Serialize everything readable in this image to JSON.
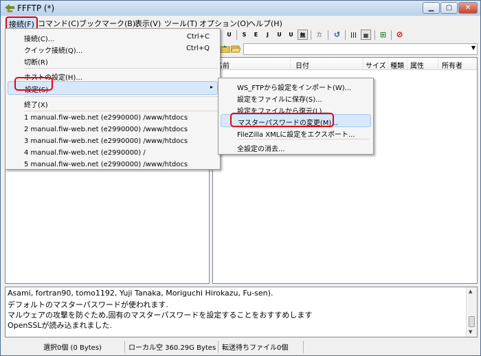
{
  "window": {
    "title": "FFFTP (*)"
  },
  "menubar": [
    "接続(F)",
    "コマンド(C)",
    "ブックマーク(B)",
    "表示(V)",
    "ツール(T)",
    "オプション(O)",
    "ヘルプ(H)"
  ],
  "toolbar": {
    "icons": [
      "↑",
      "U",
      "S",
      "E",
      "J",
      "U",
      "U",
      "無",
      "カ",
      "↺",
      "|||",
      "▦",
      "⊞",
      "⊘"
    ]
  },
  "columns": [
    "名前",
    "日付",
    "サイズ",
    "種類",
    "属性",
    "所有者"
  ],
  "main_menu": {
    "items": [
      {
        "label": "接続(C)...",
        "shortcut": "Ctrl+C"
      },
      {
        "label": "クイック接続(Q)...",
        "shortcut": "Ctrl+Q"
      },
      {
        "label": "切断(R)",
        "shortcut": ""
      },
      {
        "label": "ホストの設定(H)...",
        "shortcut": ""
      },
      {
        "label": "設定(S)",
        "shortcut": ""
      },
      {
        "label": "終了(X)",
        "shortcut": ""
      },
      {
        "label": "1 manual.fiw-web.net (e2990000) /www/htdocs",
        "shortcut": ""
      },
      {
        "label": "2 manual.fiw-web.net (e2990000) /www/htdocs",
        "shortcut": ""
      },
      {
        "label": "3 manual.fiw-web.net (e2990000) /www/htdocs",
        "shortcut": ""
      },
      {
        "label": "4 manual.fiw-web.net (e2990000) /",
        "shortcut": ""
      },
      {
        "label": "5 manual.fiw-web.net (e2990000) /www/htdocs",
        "shortcut": ""
      }
    ],
    "submenu_arrow": "▸"
  },
  "settings_submenu": {
    "items": [
      "WS_FTPから設定をインポート(W)...",
      "設定をファイルに保存(S)...",
      "設定をファイルから復元(L)...",
      "マスターパスワードの変更(M)...",
      "FileZilla XMLに設定をエクスポート...",
      "全設定の消去..."
    ]
  },
  "log": {
    "lines": [
      "Asami, fortran90, tomo1192, Yuji Tanaka, Moriguchi Hirokazu, Fu-sen).",
      "デフォルトのマスターパスワードが使われます.",
      "マルウェアの攻撃を防ぐため,固有のマスターパスワードを設定することをおすすめします",
      "OpenSSLが読み込まれました."
    ]
  },
  "statusbar": {
    "selection": "選択0個 (0 Bytes)",
    "local_free": "ローカル空 360.29G Bytes",
    "queue": "転送待ちファイル0個"
  },
  "colors": {
    "highlight_red": "#e60012",
    "menu_highlight": "#d8e8fb"
  }
}
